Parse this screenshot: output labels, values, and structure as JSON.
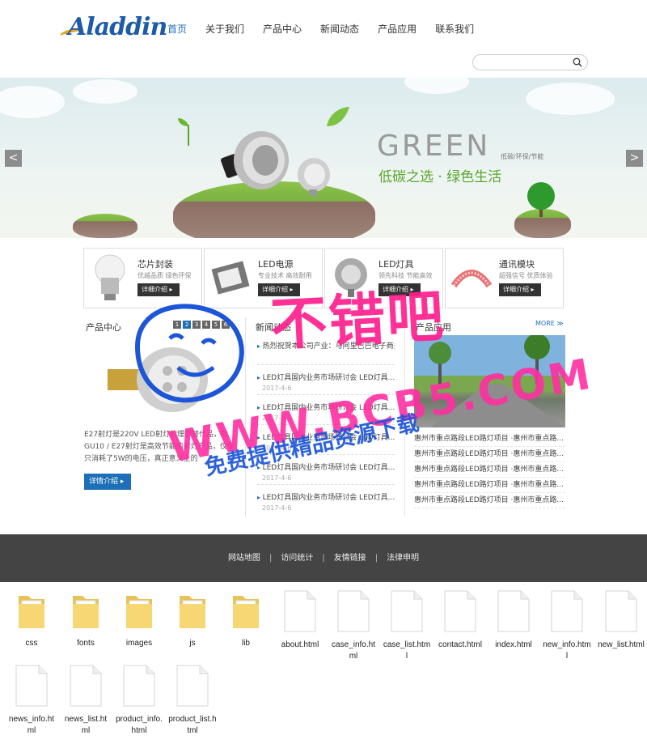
{
  "header": {
    "logo_text": "Aladdin",
    "nav": [
      "首页",
      "关于我们",
      "产品中心",
      "新闻动态",
      "产品应用",
      "联系我们"
    ],
    "search_placeholder": ""
  },
  "banner": {
    "title": "GREEN",
    "subtitle": "低碳/环保/节能",
    "slogan": "低碳之选 · 绿色生活",
    "prev": "<",
    "next": ">"
  },
  "categories": [
    {
      "title": "芯片封装",
      "desc": "优越品质 绿色环保",
      "more": "详细介绍 ▸"
    },
    {
      "title": "LED电源",
      "desc": "专业技术 高效耐用",
      "more": "详细介绍 ▸"
    },
    {
      "title": "LED灯具",
      "desc": "领先科技 节能高效",
      "more": "详细介绍 ▸"
    },
    {
      "title": "通讯模块",
      "desc": "超强信号 优质体验",
      "more": "详细介绍 ▸"
    }
  ],
  "products": {
    "title": "产品中心",
    "pages": [
      "1",
      "2",
      "3",
      "4",
      "5",
      "6"
    ],
    "active_page": 1,
    "text": "E27射灯是220V LED射灯的理想替代品，款GU10 / E27射灯是高效节能的射灯产品，仅仅只消耗了5W的电压，真正意义上的",
    "button": "详情介绍 ▸"
  },
  "news": {
    "title": "新闻动态",
    "items": [
      {
        "title": "热烈祝贺本公司产业：与阿里巴巴电子商务合作达成",
        "date": ""
      },
      {
        "title": "LED灯具国内业务市场研讨会 LED灯具...",
        "date": "2017-4-6"
      },
      {
        "title": "LED灯具国内业务市场研讨会 LED灯具...",
        "date": "2017-4-6"
      },
      {
        "title": "LED灯具国内业务市场研讨会 LED灯具...",
        "date": "2017-4-6"
      },
      {
        "title": "LED灯具国内业务市场研讨会 LED灯具...",
        "date": "2017-4-6"
      },
      {
        "title": "LED灯具国内业务市场研讨会 LED灯具...",
        "date": "2017-4-6"
      }
    ]
  },
  "applications": {
    "title": "产品应用",
    "more": "MORE ≫",
    "items": [
      "惠州市重点路段LED路灯项目 ·惠州市重点路...",
      "惠州市重点路段LED路灯项目 ·惠州市重点路...",
      "惠州市重点路段LED路灯项目 ·惠州市重点路...",
      "惠州市重点路段LED路灯项目 ·惠州市重点路...",
      "惠州市重点路段LED路灯项目 ·惠州市重点路..."
    ]
  },
  "watermark": {
    "line1": "不错吧",
    "line2": "WWW.BCB5.COM",
    "line3": "免费提供精品资源下载"
  },
  "footer": {
    "links": [
      "网站地图",
      "访问统计",
      "友情链接",
      "法律申明"
    ],
    "separator": "|"
  },
  "files": [
    {
      "name": "css",
      "type": "folder"
    },
    {
      "name": "fonts",
      "type": "folder"
    },
    {
      "name": "images",
      "type": "folder"
    },
    {
      "name": "js",
      "type": "folder"
    },
    {
      "name": "lib",
      "type": "folder"
    },
    {
      "name": "about.html",
      "type": "file"
    },
    {
      "name": "case_info.html",
      "type": "file"
    },
    {
      "name": "case_list.html",
      "type": "file"
    },
    {
      "name": "contact.html",
      "type": "file"
    },
    {
      "name": "index.html",
      "type": "file"
    },
    {
      "name": "new_info.html",
      "type": "file"
    },
    {
      "name": "new_list.html",
      "type": "file"
    },
    {
      "name": "news_info.html",
      "type": "file"
    },
    {
      "name": "news_list.html",
      "type": "file"
    },
    {
      "name": "product_info.html",
      "type": "file"
    },
    {
      "name": "product_list.html",
      "type": "file"
    }
  ],
  "colors": {
    "accent": "#1d6fb8",
    "footer_bg": "#444444",
    "watermark_pink": "#ff1f8e",
    "watermark_blue": "#1d55d8",
    "banner_green": "#5aa62a",
    "folder_yellow": "#f7d774"
  }
}
